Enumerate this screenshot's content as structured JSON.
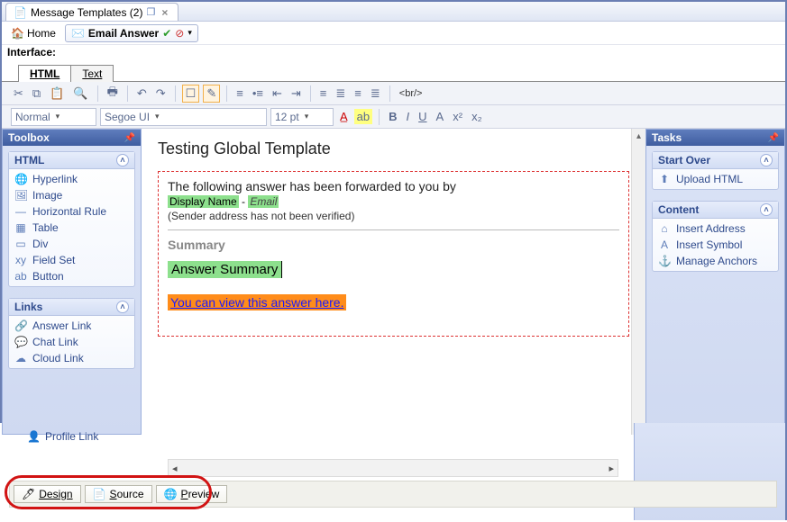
{
  "window": {
    "tab_title": "Message Templates (2)"
  },
  "toolbar": {
    "home_label": "Home",
    "email_answer_label": "Email Answer"
  },
  "interface_label": "Interface:",
  "doc_tabs": {
    "html": "HTML",
    "text": "Text"
  },
  "rt": {
    "br_label": "<br/>",
    "style": "Normal",
    "font": "Segoe UI",
    "size": "12 pt",
    "bold": "B",
    "italic": "I",
    "underline": "U",
    "fontA": "A",
    "sup": "x²",
    "sub": "x₂"
  },
  "toolbox": {
    "title": "Toolbox",
    "html_group": "HTML",
    "items_html": [
      "Hyperlink",
      "Image",
      "Horizontal Rule",
      "Table",
      "Div",
      "Field Set",
      "Button"
    ],
    "links_group": "Links",
    "items_links": [
      "Answer Link",
      "Chat Link",
      "Cloud Link"
    ],
    "profile_link": "Profile Link"
  },
  "tasks": {
    "title": "Tasks",
    "start_over": "Start Over",
    "upload_html": "Upload HTML",
    "content": "Content",
    "insert_address": "Insert Address",
    "insert_symbol": "Insert Symbol",
    "manage_anchors": "Manage Anchors"
  },
  "editor": {
    "heading": "Testing Global Template",
    "line1": "The following answer has been forwarded to you by",
    "display_name": "Display Name",
    "dash": " - ",
    "email": "Email",
    "verify": "(Sender address has not been verified)",
    "summary_label": "Summary",
    "answer_summary": "Answer Summary",
    "view_link": "You can view this answer here."
  },
  "bottom": {
    "design": "Design",
    "source": "Source",
    "preview": "Preview"
  }
}
